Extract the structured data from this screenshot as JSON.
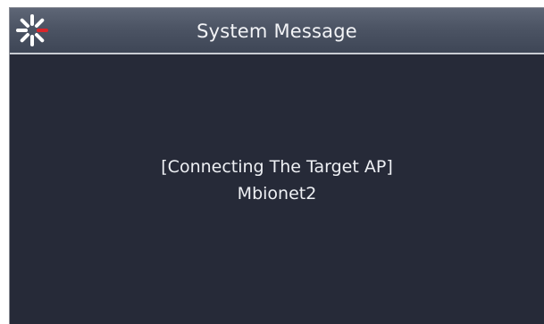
{
  "window": {
    "title": "System Message"
  },
  "message": {
    "line1": "[Connecting The Target AP]",
    "line2": "Mbionet2"
  },
  "icons": {
    "title_icon": "loading-spinner-icon"
  },
  "colors": {
    "background": "#262a38",
    "titlebar": "#4c5464",
    "text": "#eef0f4",
    "spinner_white": "#ffffff",
    "spinner_red": "#d9262b"
  }
}
